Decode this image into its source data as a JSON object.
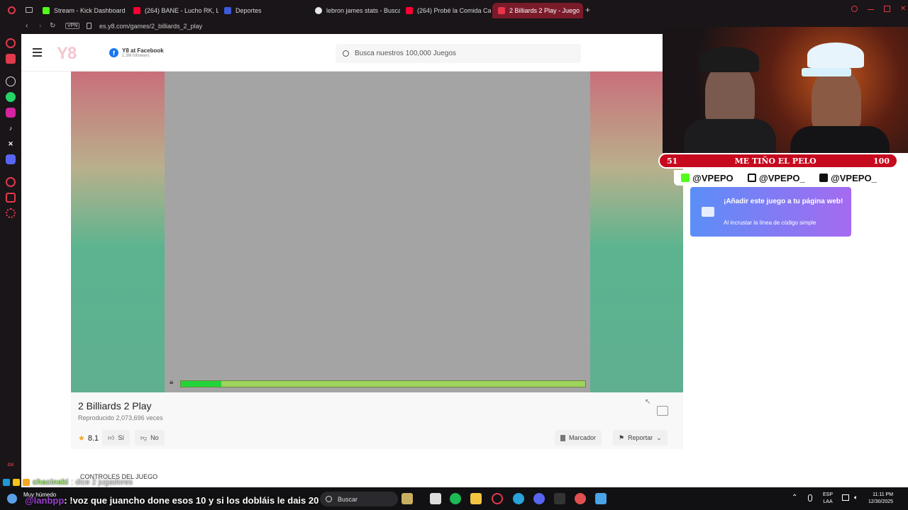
{
  "browser": {
    "tabs": [
      {
        "label": "Stream - Kick Dashboard",
        "color": "#53fc18"
      },
      {
        "label": "(264) BANE - Lucho RK, L",
        "color": "#ff0033"
      },
      {
        "label": "Deportes",
        "color": "#1e3a8a"
      },
      {
        "label": "lebron james stats - Busca",
        "color": "#e8e8e8"
      },
      {
        "label": "(264) Probé la Comida Ca",
        "color": "#ff0033"
      },
      {
        "label": "2 Billiards 2 Play - Juego",
        "color": "#e8344a"
      }
    ],
    "vpn": "VPN",
    "url": "es.y8.com/games/2_billiards_2_play"
  },
  "header": {
    "logo": "Y8",
    "facebook_title": "Y8 at Facebook",
    "facebook_sub": "1.3M followers",
    "search_placeholder": "Busca nuestros 100,000 Juegos"
  },
  "game": {
    "loading_progress": 0.1,
    "title": "2 Billiards 2 Play",
    "played": "Reproducido 2,073,696 veces",
    "rating": "8.1",
    "like_label": "Sí",
    "dislike_label": "No",
    "bookmark_label": "Marcador",
    "report_label": "Reportar",
    "controls_heading": "CONTROLES DEL JUEGO"
  },
  "embed": {
    "title": "¡Añadir este juego a tu página web!",
    "subtitle": "Al incrustar la línea de código simple"
  },
  "stream": {
    "goal_current": "51",
    "goal_label": "ME TIÑO EL PELO",
    "goal_target": "100",
    "socials": [
      "@VPEPO",
      "@VPEPO_",
      "@VPEPO_"
    ]
  },
  "chat": {
    "line1_name": "chacinski",
    "line1_msg": ": dice 2 jugadores",
    "line2_name": "@lanbpp",
    "line2_msg": ": !voz que juancho done esos 10 y si los dobláis le dais 20"
  },
  "taskbar": {
    "weather": "Muy húmedo",
    "search": "Buscar",
    "lang": "ESP",
    "lang2": "LAA",
    "time": "11:11 PM",
    "date": "12/30/2025"
  }
}
